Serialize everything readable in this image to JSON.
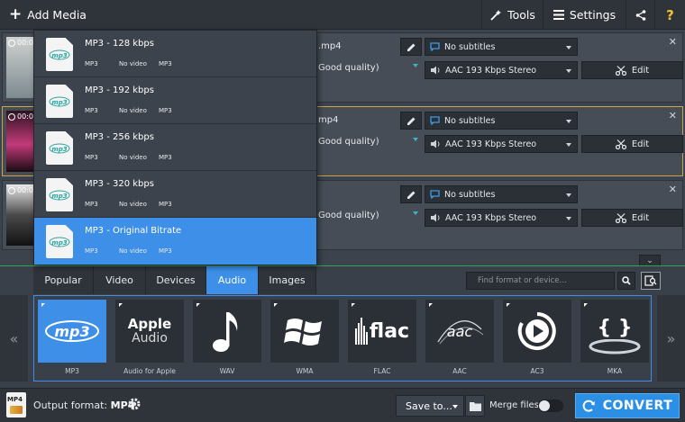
{
  "toolbar": {
    "add_media": "Add Media",
    "tools": "Tools",
    "settings": "Settings",
    "help": "?"
  },
  "files": [
    {
      "duration": "00:0",
      "name_tail": ".mp4",
      "quality_tail": "Good quality)",
      "subtitles": "No subtitles",
      "audio": "AAC 193 Kbps Stereo",
      "edit": "Edit",
      "close": "✕",
      "selected": false
    },
    {
      "duration": "00:0",
      "name_tail": "mp4",
      "quality_tail": "Good quality)",
      "subtitles": "No subtitles",
      "audio": "AAC 193 Kbps Stereo",
      "edit": "Edit",
      "close": "✕",
      "selected": true
    },
    {
      "duration": "00:0",
      "name_tail": "",
      "quality_tail": "Good quality)",
      "subtitles": "No subtitles",
      "audio": "AAC 193 Kbps Stereo",
      "edit": "Edit",
      "close": "✕",
      "selected": false
    }
  ],
  "presets": [
    {
      "name": "MP3 - 128 kbps",
      "codec": "MP3",
      "video": "No video",
      "audio_codec": "MP3",
      "active": false
    },
    {
      "name": "MP3 - 192 kbps",
      "codec": "MP3",
      "video": "No video",
      "audio_codec": "MP3",
      "active": false
    },
    {
      "name": "MP3 - 256 kbps",
      "codec": "MP3",
      "video": "No video",
      "audio_codec": "MP3",
      "active": false
    },
    {
      "name": "MP3 - 320 kbps",
      "codec": "MP3",
      "video": "No video",
      "audio_codec": "MP3",
      "active": false
    },
    {
      "name": "MP3 - Original Bitrate",
      "codec": "MP3",
      "video": "No video",
      "audio_codec": "MP3",
      "active": true
    }
  ],
  "format_tabs": [
    {
      "label": "Popular",
      "active": false
    },
    {
      "label": "Video",
      "active": false
    },
    {
      "label": "Devices",
      "active": false
    },
    {
      "label": "Audio",
      "active": true
    },
    {
      "label": "Images",
      "active": false
    }
  ],
  "search": {
    "placeholder": "Find format or device..."
  },
  "formats": [
    {
      "label": "MP3",
      "icon": "mp3-logo-icon",
      "active": true
    },
    {
      "label": "Audio for Apple",
      "icon": "apple-audio-icon",
      "active": false,
      "logo_text_1": "Apple",
      "logo_text_2": "Audio"
    },
    {
      "label": "WAV",
      "icon": "music-note-icon",
      "active": false
    },
    {
      "label": "WMA",
      "icon": "windows-logo-icon",
      "active": false
    },
    {
      "label": "FLAC",
      "icon": "flac-logo-icon",
      "active": false,
      "logo_text_1": "flac"
    },
    {
      "label": "AAC",
      "icon": "aac-logo-icon",
      "active": false,
      "logo_text_1": "aac"
    },
    {
      "label": "AC3",
      "icon": "ac3-play-icon",
      "active": false
    },
    {
      "label": "MKA",
      "icon": "mka-logo-icon",
      "active": false,
      "logo_text_1": "{ }"
    }
  ],
  "nav": {
    "prev": "«",
    "next": "»"
  },
  "bottom": {
    "output_label": "Output format:",
    "output_value": "MP4",
    "mp4_icon_text": "MP4",
    "save_to": "Save to...",
    "merge_files": "Merge files:",
    "convert": "CONVERT"
  },
  "colors": {
    "accent": "#3d8fe8",
    "selected_border": "#c9a44a",
    "divider": "#2fa35a"
  }
}
